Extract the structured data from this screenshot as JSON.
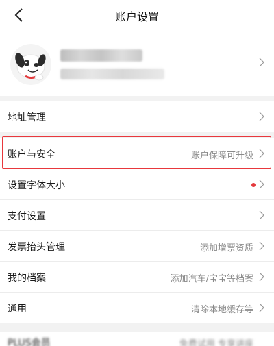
{
  "header": {
    "title": "账户设置"
  },
  "icons": {
    "back": "chevron-left-icon",
    "chevron": "chevron-right-icon",
    "avatar": "jd-dog-mascot"
  },
  "colors": {
    "accent_red": "#e8383d",
    "value_gray": "#8a8a8a",
    "background": "#f2f2f2"
  },
  "group1": [
    {
      "label": "地址管理",
      "value": ""
    }
  ],
  "group2": [
    {
      "label": "账户与安全",
      "value": "账户保障可升级"
    },
    {
      "label": "设置字体大小",
      "value": ""
    },
    {
      "label": "支付设置",
      "value": ""
    },
    {
      "label": "发票抬头管理",
      "value": "添加增票资质"
    },
    {
      "label": "我的档案",
      "value": "添加汽车/宝宝等档案"
    },
    {
      "label": "通用",
      "value": "清除本地缓存等"
    }
  ],
  "partial_row": {
    "label": "PLUS会员",
    "value": "免费试用 专享讲座"
  }
}
